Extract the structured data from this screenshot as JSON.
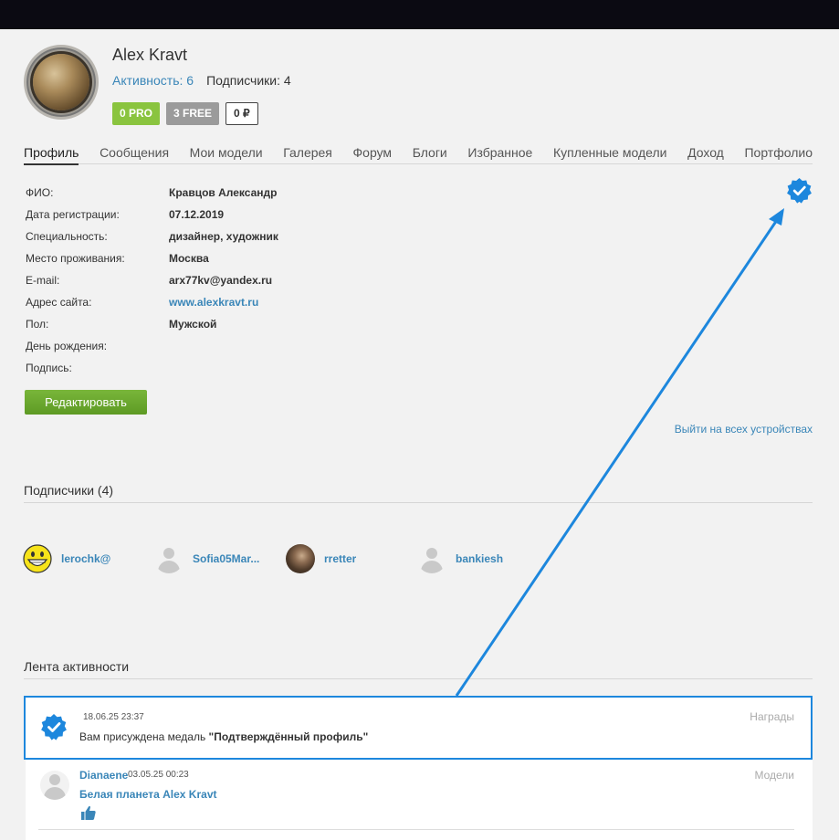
{
  "profile": {
    "name": "Alex Kravt",
    "activity": "Активность: 6",
    "subscribers_count": "Подписчики: 4",
    "badges": {
      "pro": "0 PRO",
      "free": "3 FREE",
      "rub": "0 ₽"
    }
  },
  "tabs": [
    "Профиль",
    "Сообщения",
    "Мои модели",
    "Галерея",
    "Форум",
    "Блоги",
    "Избранное",
    "Купленные модели",
    "Доход",
    "Портфолио"
  ],
  "info": {
    "fio": {
      "label": "ФИО:",
      "value": "Кравцов Александр"
    },
    "reg_date": {
      "label": "Дата регистрации:",
      "value": "07.12.2019"
    },
    "specialty": {
      "label": "Специальность:",
      "value": "дизайнер, художник"
    },
    "location": {
      "label": "Место проживания:",
      "value": "Москва"
    },
    "email": {
      "label": "E-mail:",
      "value": "arx77kv@yandex.ru"
    },
    "website": {
      "label": "Адрес сайта:",
      "value": "www.alexkravt.ru"
    },
    "gender": {
      "label": "Пол:",
      "value": "Мужской"
    },
    "birthday": {
      "label": "День рождения:",
      "value": ""
    },
    "signature": {
      "label": "Подпись:",
      "value": ""
    }
  },
  "edit_button": "Редактировать",
  "logout_all": "Выйти на всех устройствах",
  "subscribers_section": {
    "title": "Подписчики (4)",
    "items": [
      {
        "name": "lerochk@",
        "avatar": "smiley"
      },
      {
        "name": "Sofia05Mar...",
        "avatar": "default"
      },
      {
        "name": "rretter",
        "avatar": "photo"
      },
      {
        "name": "bankiesh",
        "avatar": "default"
      }
    ]
  },
  "feed": {
    "title": "Лента активности",
    "items": [
      {
        "date": "18.06.25 23:37",
        "category": "Награды",
        "message_prefix": "Вам присуждена медаль ",
        "message_bold": "\"Подтверждённый профиль\""
      },
      {
        "user": "Dianaene",
        "date": "03.05.25 00:23",
        "category": "Модели",
        "title": "Белая планета Alex Kravt"
      }
    ]
  },
  "colors": {
    "accent": "#3a86b8",
    "verified": "#1d87dd",
    "pro": "#8ac43f",
    "free": "#9b9b9b",
    "edit": "#6aa82e"
  }
}
